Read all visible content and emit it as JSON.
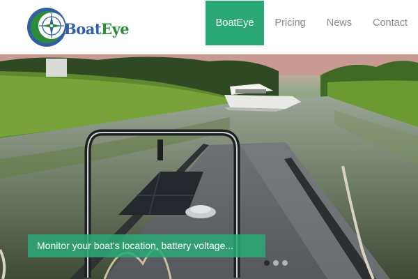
{
  "brand": {
    "name_part1": "Boat",
    "name_part2": "Eye",
    "colors": {
      "primary": "#2aa876",
      "logo_blue": "#2f5fa5",
      "logo_green": "#2d8a3a"
    }
  },
  "nav": {
    "items": [
      {
        "label": "BoatEye",
        "active": true
      },
      {
        "label": "Pricing",
        "active": false
      },
      {
        "label": "News",
        "active": false
      },
      {
        "label": "Contact",
        "active": false
      }
    ]
  },
  "hero": {
    "caption": "Monitor your boat's location, battery voltage...",
    "slide_count": 3,
    "active_slide": 1
  }
}
